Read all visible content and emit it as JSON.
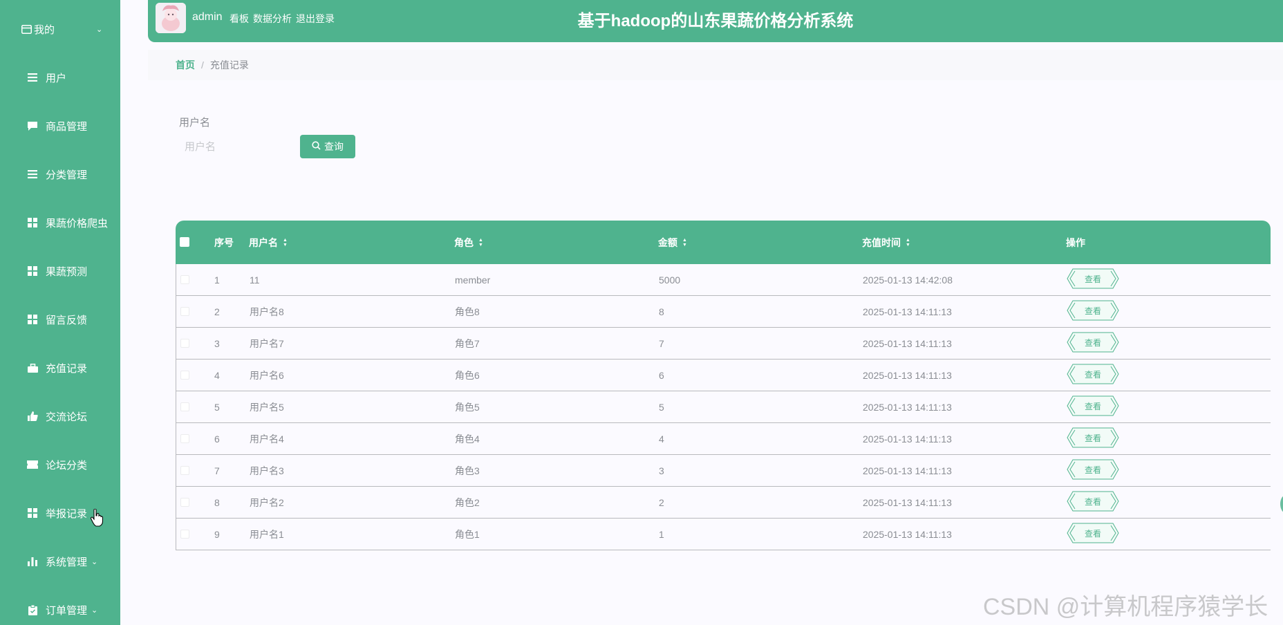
{
  "sidebar": {
    "items": [
      {
        "label": "我的",
        "icon": "card-icon"
      },
      {
        "label": "用户",
        "icon": "list-icon"
      },
      {
        "label": "商品管理",
        "icon": "chat-icon"
      },
      {
        "label": "分类管理",
        "icon": "list-icon"
      },
      {
        "label": "果蔬价格爬虫",
        "icon": "grid-icon"
      },
      {
        "label": "果蔬预测",
        "icon": "grid-icon"
      },
      {
        "label": "留言反馈",
        "icon": "grid-icon"
      },
      {
        "label": "充值记录",
        "icon": "briefcase-icon"
      },
      {
        "label": "交流论坛",
        "icon": "thumb-icon"
      },
      {
        "label": "论坛分类",
        "icon": "ticket-icon"
      },
      {
        "label": "举报记录",
        "icon": "grid-icon"
      },
      {
        "label": "系统管理",
        "icon": "bar-chart-icon"
      },
      {
        "label": "订单管理",
        "icon": "clipboard-icon"
      }
    ]
  },
  "header": {
    "username": "admin",
    "links": [
      "看板",
      "数据分析",
      "退出登录"
    ],
    "title": "基于hadoop的山东果蔬价格分析系统"
  },
  "breadcrumb": {
    "home": "首页",
    "separator": "/",
    "current": "充值记录"
  },
  "search": {
    "label": "用户名",
    "placeholder": "用户名",
    "button": "查询"
  },
  "table": {
    "headers": {
      "index": "序号",
      "username": "用户名",
      "role": "角色",
      "amount": "金额",
      "time": "充值时间",
      "action": "操作"
    },
    "action_label": "查看",
    "rows": [
      {
        "index": "1",
        "username": "11",
        "role": "member",
        "amount": "5000",
        "time": "2025-01-13 14:42:08"
      },
      {
        "index": "2",
        "username": "用户名8",
        "role": "角色8",
        "amount": "8",
        "time": "2025-01-13 14:11:13"
      },
      {
        "index": "3",
        "username": "用户名7",
        "role": "角色7",
        "amount": "7",
        "time": "2025-01-13 14:11:13"
      },
      {
        "index": "4",
        "username": "用户名6",
        "role": "角色6",
        "amount": "6",
        "time": "2025-01-13 14:11:13"
      },
      {
        "index": "5",
        "username": "用户名5",
        "role": "角色5",
        "amount": "5",
        "time": "2025-01-13 14:11:13"
      },
      {
        "index": "6",
        "username": "用户名4",
        "role": "角色4",
        "amount": "4",
        "time": "2025-01-13 14:11:13"
      },
      {
        "index": "7",
        "username": "用户名3",
        "role": "角色3",
        "amount": "3",
        "time": "2025-01-13 14:11:13"
      },
      {
        "index": "8",
        "username": "用户名2",
        "role": "角色2",
        "amount": "2",
        "time": "2025-01-13 14:11:13"
      },
      {
        "index": "9",
        "username": "用户名1",
        "role": "角色1",
        "amount": "1",
        "time": "2025-01-13 14:11:13"
      }
    ]
  },
  "watermark": "CSDN @计算机程序猿学长",
  "colors": {
    "primary": "#4fb38e",
    "background": "#fbfaff",
    "text": "#8a8d93"
  }
}
